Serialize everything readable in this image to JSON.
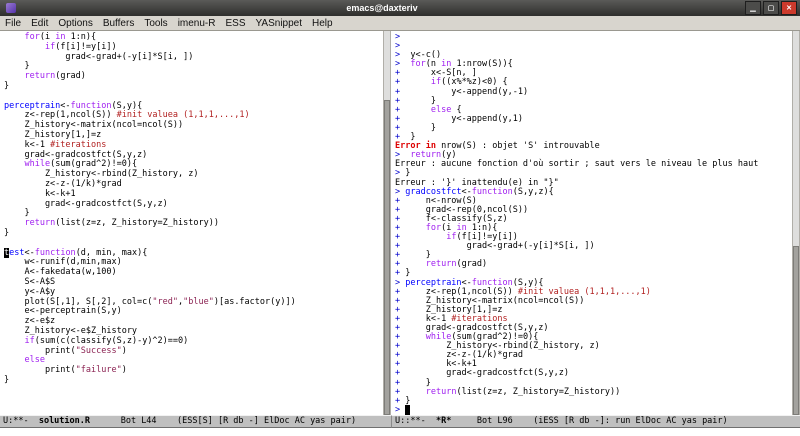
{
  "window": {
    "title": "emacs@daxteriv"
  },
  "window_buttons": {
    "minimize": "▁",
    "maximize": "▢",
    "close": "✕"
  },
  "menu_bar": {
    "items": [
      "File",
      "Edit",
      "Options",
      "Buffers",
      "Tools",
      "imenu-R",
      "ESS",
      "YASnippet",
      "Help"
    ]
  },
  "colors": {
    "kw": "#a020f0",
    "fn": "#0000ff",
    "cm": "#b22222",
    "st": "#8b2252",
    "pr": "#0000cd",
    "er": "#dd0000",
    "modeline_bg": "#bfbfbf",
    "menubar_bg": "#d8d5ce",
    "close_btn": "#cc3a2c"
  },
  "source_window": {
    "lines": [
      [
        [
          "pl",
          "    "
        ],
        [
          "kw",
          "for"
        ],
        [
          "pl",
          "(i "
        ],
        [
          "kw",
          "in"
        ],
        [
          "pl",
          " 1:n){"
        ]
      ],
      [
        [
          "pl",
          "        "
        ],
        [
          "kw",
          "if"
        ],
        [
          "pl",
          "(f[i]!=y[i])"
        ]
      ],
      [
        [
          "pl",
          "            grad<-grad+(-y[i]*S[i, ])"
        ]
      ],
      [
        [
          "pl",
          "    }"
        ]
      ],
      [
        [
          "pl",
          "    "
        ],
        [
          "kw",
          "return"
        ],
        [
          "pl",
          "(grad)"
        ]
      ],
      [
        [
          "pl",
          "}"
        ]
      ],
      [],
      [
        [
          "fn",
          "perceptrain"
        ],
        [
          "pl",
          "<-"
        ],
        [
          "kw",
          "function"
        ],
        [
          "pl",
          "(S,y){"
        ]
      ],
      [
        [
          "pl",
          "    z<-rep(1,ncol(S)) "
        ],
        [
          "cm",
          "#init valuea (1,1,1,...,1)"
        ]
      ],
      [
        [
          "pl",
          "    Z_history<-matrix(ncol=ncol(S))"
        ]
      ],
      [
        [
          "pl",
          "    Z_history[1,]=z"
        ]
      ],
      [
        [
          "pl",
          "    k<-1 "
        ],
        [
          "cm",
          "#iterations"
        ]
      ],
      [
        [
          "pl",
          "    grad<-gradcostfct(S,y,z)"
        ]
      ],
      [
        [
          "pl",
          "    "
        ],
        [
          "kw",
          "while"
        ],
        [
          "pl",
          "(sum(grad^2)!=0){"
        ]
      ],
      [
        [
          "pl",
          "        Z_history<-rbind(Z_history, z)"
        ]
      ],
      [
        [
          "pl",
          "        z<-z-(1/k)*grad"
        ]
      ],
      [
        [
          "pl",
          "        k<-k+1"
        ]
      ],
      [
        [
          "pl",
          "        grad<-gradcostfct(S,y,z)"
        ]
      ],
      [
        [
          "pl",
          "    }"
        ]
      ],
      [
        [
          "pl",
          "    "
        ],
        [
          "kw",
          "return"
        ],
        [
          "pl",
          "(list(z=z, Z_history=Z_history))"
        ]
      ],
      [
        [
          "pl",
          "}"
        ]
      ],
      [],
      [
        [
          "cur",
          "t"
        ],
        [
          "fn",
          "est"
        ],
        [
          "pl",
          "<-"
        ],
        [
          "kw",
          "function"
        ],
        [
          "pl",
          "(d, min, max){"
        ]
      ],
      [
        [
          "pl",
          "    w<-runif(d,min,max)"
        ]
      ],
      [
        [
          "pl",
          "    A<-fakedata(w,100)"
        ]
      ],
      [
        [
          "pl",
          "    S<-A$S"
        ]
      ],
      [
        [
          "pl",
          "    y<-A$y"
        ]
      ],
      [
        [
          "pl",
          "    plot(S[,1], S[,2], col=c("
        ],
        [
          "st",
          "\"red\""
        ],
        [
          "pl",
          ","
        ],
        [
          "st",
          "\"blue\""
        ],
        [
          "pl",
          ")[as.factor(y)])"
        ]
      ],
      [
        [
          "pl",
          "    e<-perceptrain(S,y)"
        ]
      ],
      [
        [
          "pl",
          "    z<-e$z"
        ]
      ],
      [
        [
          "pl",
          "    Z_history<-e$Z_history"
        ]
      ],
      [
        [
          "pl",
          "    "
        ],
        [
          "kw",
          "if"
        ],
        [
          "pl",
          "(sum(c(classify(S,z)-y)^2)==0)"
        ]
      ],
      [
        [
          "pl",
          "        print("
        ],
        [
          "st",
          "\"Success\""
        ],
        [
          "pl",
          ")"
        ]
      ],
      [
        [
          "pl",
          "    "
        ],
        [
          "kw",
          "else"
        ]
      ],
      [
        [
          "pl",
          "        print("
        ],
        [
          "st",
          "\"failure\""
        ],
        [
          "pl",
          ")"
        ]
      ],
      [
        [
          "pl",
          "}"
        ]
      ]
    ]
  },
  "console_window": {
    "lines": [
      [
        [
          "pr",
          "> "
        ]
      ],
      [
        [
          "pr",
          "> "
        ]
      ],
      [
        [
          "pr",
          "> "
        ],
        [
          "pl",
          " y<-c()"
        ]
      ],
      [
        [
          "pr",
          "> "
        ],
        [
          "pl",
          " "
        ],
        [
          "kw",
          "for"
        ],
        [
          "pl",
          "(n "
        ],
        [
          "kw",
          "in"
        ],
        [
          "pl",
          " 1:nrow(S)){"
        ]
      ],
      [
        [
          "pr",
          "+ "
        ],
        [
          "pl",
          "     x<-S[n, ]"
        ]
      ],
      [
        [
          "pr",
          "+ "
        ],
        [
          "pl",
          "     "
        ],
        [
          "kw",
          "if"
        ],
        [
          "pl",
          "((x%*%z)<0) {"
        ]
      ],
      [
        [
          "pr",
          "+ "
        ],
        [
          "pl",
          "         y<-append(y,-1)"
        ]
      ],
      [
        [
          "pr",
          "+ "
        ],
        [
          "pl",
          "     }"
        ]
      ],
      [
        [
          "pr",
          "+ "
        ],
        [
          "pl",
          "     "
        ],
        [
          "kw",
          "else"
        ],
        [
          "pl",
          " {"
        ]
      ],
      [
        [
          "pr",
          "+ "
        ],
        [
          "pl",
          "         y<-append(y,1)"
        ]
      ],
      [
        [
          "pr",
          "+ "
        ],
        [
          "pl",
          "     }"
        ]
      ],
      [
        [
          "pr",
          "+ "
        ],
        [
          "pl",
          " }"
        ]
      ],
      [
        [
          "er",
          "Error in"
        ],
        [
          "pl",
          " nrow(S) : objet 'S' introuvable"
        ]
      ],
      [
        [
          "pr",
          "> "
        ],
        [
          "pl",
          " "
        ],
        [
          "kw",
          "return"
        ],
        [
          "pl",
          "(y)"
        ]
      ],
      [
        [
          "pl",
          "Erreur : aucune fonction d'où sortir ; saut vers le niveau le plus haut"
        ]
      ],
      [
        [
          "pr",
          "> "
        ],
        [
          "pl",
          "}"
        ]
      ],
      [
        [
          "pl",
          "Erreur : '}' inattendu(e) in \"}\""
        ]
      ],
      [
        [
          "pr",
          "> "
        ],
        [
          "fn",
          "gradcostfct"
        ],
        [
          "pl",
          "<-"
        ],
        [
          "kw",
          "function"
        ],
        [
          "pl",
          "(S,y,z){"
        ]
      ],
      [
        [
          "pr",
          "+ "
        ],
        [
          "pl",
          "    n<-nrow(S)"
        ]
      ],
      [
        [
          "pr",
          "+ "
        ],
        [
          "pl",
          "    grad<-rep(0,ncol(S))"
        ]
      ],
      [
        [
          "pr",
          "+ "
        ],
        [
          "pl",
          "    f<-classify(S,z)"
        ]
      ],
      [
        [
          "pr",
          "+ "
        ],
        [
          "pl",
          "    "
        ],
        [
          "kw",
          "for"
        ],
        [
          "pl",
          "(i "
        ],
        [
          "kw",
          "in"
        ],
        [
          "pl",
          " 1:n){"
        ]
      ],
      [
        [
          "pr",
          "+ "
        ],
        [
          "pl",
          "        "
        ],
        [
          "kw",
          "if"
        ],
        [
          "pl",
          "(f[i]!=y[i])"
        ]
      ],
      [
        [
          "pr",
          "+ "
        ],
        [
          "pl",
          "            grad<-grad+(-y[i]*S[i, ])"
        ]
      ],
      [
        [
          "pr",
          "+ "
        ],
        [
          "pl",
          "    }"
        ]
      ],
      [
        [
          "pr",
          "+ "
        ],
        [
          "pl",
          "    "
        ],
        [
          "kw",
          "return"
        ],
        [
          "pl",
          "(grad)"
        ]
      ],
      [
        [
          "pr",
          "+ "
        ],
        [
          "pl",
          "}"
        ]
      ],
      [
        [
          "pr",
          "> "
        ],
        [
          "fn",
          "perceptrain"
        ],
        [
          "pl",
          "<-"
        ],
        [
          "kw",
          "function"
        ],
        [
          "pl",
          "(S,y){"
        ]
      ],
      [
        [
          "pr",
          "+ "
        ],
        [
          "pl",
          "    z<-rep(1,ncol(S)) "
        ],
        [
          "cm",
          "#init valuea (1,1,1,...,1)"
        ]
      ],
      [
        [
          "pr",
          "+ "
        ],
        [
          "pl",
          "    Z_history<-matrix(ncol=ncol(S))"
        ]
      ],
      [
        [
          "pr",
          "+ "
        ],
        [
          "pl",
          "    Z_history[1,]=z"
        ]
      ],
      [
        [
          "pr",
          "+ "
        ],
        [
          "pl",
          "    k<-1 "
        ],
        [
          "cm",
          "#iterations"
        ]
      ],
      [
        [
          "pr",
          "+ "
        ],
        [
          "pl",
          "    grad<-gradcostfct(S,y,z)"
        ]
      ],
      [
        [
          "pr",
          "+ "
        ],
        [
          "pl",
          "    "
        ],
        [
          "kw",
          "while"
        ],
        [
          "pl",
          "(sum(grad^2)!=0){"
        ]
      ],
      [
        [
          "pr",
          "+ "
        ],
        [
          "pl",
          "        Z_history<-rbind(Z_history, z)"
        ]
      ],
      [
        [
          "pr",
          "+ "
        ],
        [
          "pl",
          "        z<-z-(1/k)*grad"
        ]
      ],
      [
        [
          "pr",
          "+ "
        ],
        [
          "pl",
          "        k<-k+1"
        ]
      ],
      [
        [
          "pr",
          "+ "
        ],
        [
          "pl",
          "        grad<-gradcostfct(S,y,z)"
        ]
      ],
      [
        [
          "pr",
          "+ "
        ],
        [
          "pl",
          "    }"
        ]
      ],
      [
        [
          "pr",
          "+ "
        ],
        [
          "pl",
          "    "
        ],
        [
          "kw",
          "return"
        ],
        [
          "pl",
          "(list(z=z, Z_history=Z_history))"
        ]
      ],
      [
        [
          "pr",
          "+ "
        ],
        [
          "pl",
          "}"
        ]
      ],
      [
        [
          "pr",
          "> "
        ],
        [
          "cur",
          " "
        ]
      ]
    ]
  },
  "modeline_left": {
    "segments": [
      [
        "pl",
        "U:**-  "
      ],
      [
        "bold",
        "solution.R"
      ],
      [
        "pl",
        "      Bot L44    (ESS[S] [R db -] ElDoc AC yas pair)"
      ]
    ]
  },
  "modeline_right": {
    "segments": [
      [
        "pl",
        "U::**-  "
      ],
      [
        "bold",
        "*R*"
      ],
      [
        "pl",
        "     Bot L96    (iESS [R db -]: run ElDoc AC yas pair)"
      ]
    ]
  },
  "minibuffer": {
    "text": ""
  }
}
